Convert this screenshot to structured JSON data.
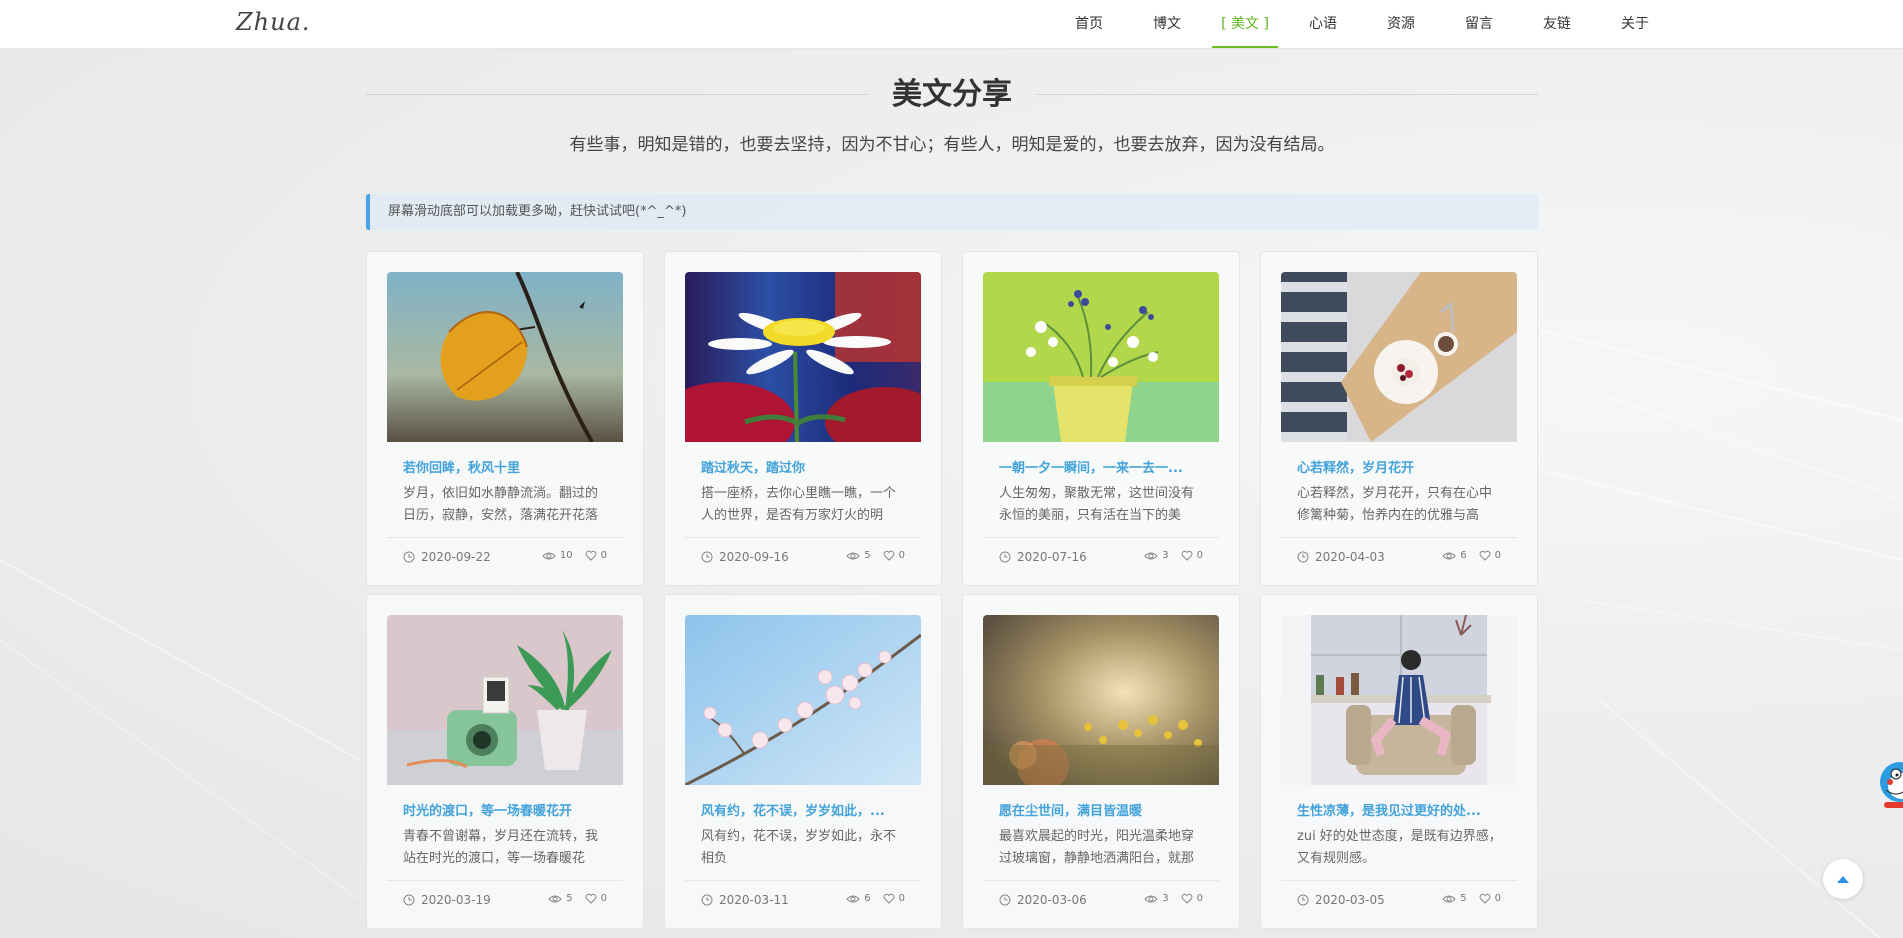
{
  "site": {
    "logo": "Zhua."
  },
  "nav": [
    {
      "label": "首页"
    },
    {
      "label": "博文"
    },
    {
      "label": "[ 美文 ]",
      "active": true
    },
    {
      "label": "心语"
    },
    {
      "label": "资源"
    },
    {
      "label": "留言"
    },
    {
      "label": "友链"
    },
    {
      "label": "关于"
    }
  ],
  "page": {
    "title": "美文分享",
    "subtitle": "有些事，明知是错的，也要去坚持，因为不甘心；有些人，明知是爱的，也要去放弃，因为没有结局。",
    "notice": "屏幕滑动底部可以加载更多呦，赶快试试吧(*^_^*)"
  },
  "colors": {
    "accent": "#5fb31f",
    "title": "#43a3db",
    "notice_border": "#45a3e5"
  },
  "articles": [
    {
      "title": "若你回眸，秋风十里",
      "excerpt": "岁月，依旧如水静静流淌。翻过的日历，寂静，安然，落满花开花落",
      "date": "2020-09-22",
      "views": "10",
      "likes": "0",
      "image": "autumn-leaf"
    },
    {
      "title": "踏过秋天，踏过你",
      "excerpt": "搭一座桥，去你心里瞧一瞧，一个人的世界，是否有万家灯火的明",
      "date": "2020-09-16",
      "views": "5",
      "likes": "0",
      "image": "daisy"
    },
    {
      "title": "一朝一夕一瞬间，一来一去一...",
      "excerpt": "人生匆匆，聚散无常，这世间没有永恒的美丽，只有活在当下的美",
      "date": "2020-07-16",
      "views": "3",
      "likes": "0",
      "image": "flower-pot"
    },
    {
      "title": "心若释然，岁月花开",
      "excerpt": "心若释然，岁月花开，只有在心中修篱种菊，怡养内在的优雅与高",
      "date": "2020-04-03",
      "views": "6",
      "likes": "0",
      "image": "dessert-tray"
    },
    {
      "title": "时光的渡口，等一场春暖花开",
      "excerpt": "青春不曾谢幕，岁月还在流转，我站在时光的渡口，等一场春暖花",
      "date": "2020-03-19",
      "views": "5",
      "likes": "0",
      "image": "camera-plant"
    },
    {
      "title": "风有约，花不误，岁岁如此，...",
      "excerpt": "风有约，花不误，岁岁如此，永不相负",
      "date": "2020-03-11",
      "views": "6",
      "likes": "0",
      "image": "cherry-blossom"
    },
    {
      "title": "愿在尘世间，满目皆温暖",
      "excerpt": "最喜欢晨起的时光，阳光温柔地穿过玻璃窗，静静地洒满阳台，就那",
      "date": "2020-03-06",
      "views": "3",
      "likes": "0",
      "image": "sunlit-flowers"
    },
    {
      "title": "生性凉薄，是我见过更好的处...",
      "excerpt": "zui 好的处世态度，是既有边界感，又有规则感。",
      "date": "2020-03-05",
      "views": "5",
      "likes": "0",
      "image": "girl-armchair"
    }
  ]
}
